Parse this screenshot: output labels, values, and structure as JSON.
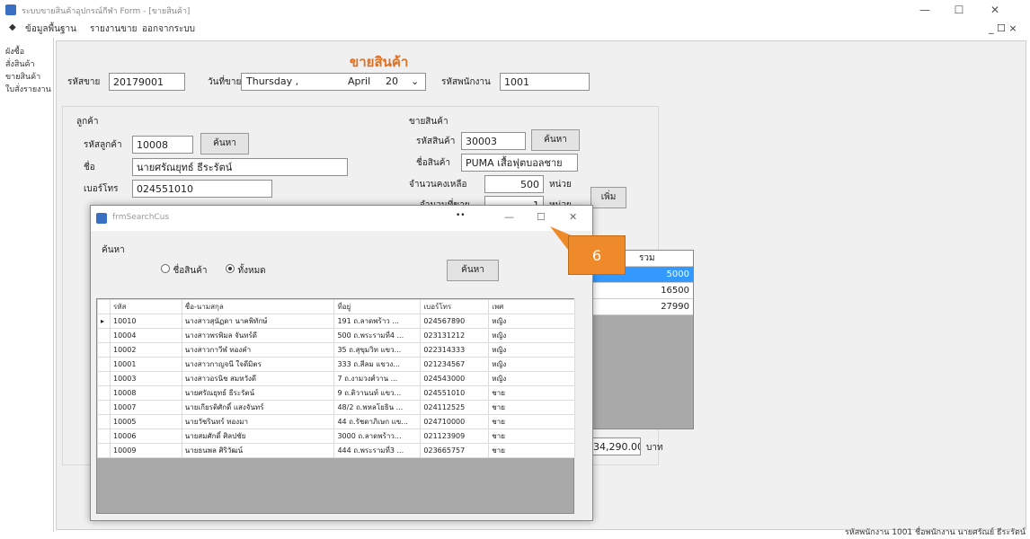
{
  "window": {
    "title": "ระบบขายสินค้าอุปกรณ์กีฬา Form - [ขายสินค้า]",
    "controls": {
      "minimize": "—",
      "maximize": "☐",
      "close": "✕"
    },
    "mdi_controls": "_ ☐ ×"
  },
  "menu": {
    "items": [
      "ข้อมูลพื้นฐาน",
      "รายงานขาย",
      "ออกจากระบบ"
    ]
  },
  "sidebar": {
    "items": [
      "ผังซื้อ",
      "สั่งสินค้า",
      "ขายสินค้า",
      "ใบสั่งรายงาน"
    ]
  },
  "sale_form": {
    "heading": "ขายสินค้า",
    "sale_id_label": "รหัสขาย",
    "sale_id": "20179001",
    "date_label": "วันที่ขาย",
    "date_weekday": "Thursday ,",
    "date_month": "April",
    "date_day": "20",
    "employee_id_label": "รหัสพนักงาน",
    "employee_id": "1001"
  },
  "customer": {
    "group_title": "ลูกค้า",
    "id_label": "รหัสลูกค้า",
    "id": "10008",
    "search_button": "ค้นหา",
    "name_label": "ชื่อ",
    "name": "นายศรัณยุทธ์ ธีระรัตน์",
    "phone_label": "เบอร์โทร",
    "phone": "024551010"
  },
  "product": {
    "group_title": "ขายสินค้า",
    "id_label": "รหัสสินค้า",
    "id": "30003",
    "search_button": "ค้นหา",
    "name_label": "ชื่อสินค้า",
    "name": "PUMA เสื้อฟุตบอลชาย",
    "stock_label": "จำนวนคงเหลือ",
    "stock": "500",
    "stock_unit": "หน่วย",
    "qty_label": "จำนวนที่ขาย",
    "qty": "1",
    "qty_unit": "หน่วย",
    "add_button": "เพิ่ม"
  },
  "right_grid": {
    "header": "รวม",
    "values": [
      "5000",
      "16500",
      "27990"
    ]
  },
  "total": {
    "value": "34,290.00",
    "unit": "บาท"
  },
  "dialog": {
    "title": "frmSearchCus",
    "controls": {
      "pin": "••",
      "minimize": "—",
      "maximize": "☐",
      "close": "✕"
    },
    "search_label": "ค้นหา",
    "radio_product": "ชื่อสินค้า",
    "radio_all": "ทั้งหมด",
    "selected_radio": "all",
    "search_button": "ค้นหา",
    "grid": {
      "columns": [
        "",
        "รหัส",
        "ชื่อ-นามสกุล",
        "ที่อยู่",
        "เบอร์โทร",
        "เพศ"
      ],
      "rows": [
        [
          "▸",
          "10010",
          "นางสาวสุนัฏดา นาคพิทักษ์",
          "191 ถ.ลาดพร้าว ...",
          "024567890",
          "หญิง"
        ],
        [
          "",
          "10004",
          "นางสาวพรพิมล จันทร์ดี",
          "500 ถ.พระรามที่4 ...",
          "023131212",
          "หญิง"
        ],
        [
          "",
          "10002",
          "นางสาวกาวีฬ ทองคำ",
          "35 ถ.สุขุมวิท แขว...",
          "022314333",
          "หญิง"
        ],
        [
          "",
          "10001",
          "นางสาวกาญจนี ใจดีมิตร",
          "333 ถ.สีลม แขวง...",
          "021234567",
          "หญิง"
        ],
        [
          "",
          "10003",
          "นางสาวอรนิช สมหวังดี",
          "7 ถ.งามวงศ์วาน ...",
          "024543000",
          "หญิง"
        ],
        [
          "",
          "10008",
          "นายศรัณยุทธ์ ธีระรัตน์",
          "9 ถ.ติวานนท์ แขว...",
          "024551010",
          "ชาย"
        ],
        [
          "",
          "10007",
          "นายเกียรติศักดิ์ แสงจันทร์",
          "48/2 ถ.พหลโยธิน ...",
          "024112525",
          "ชาย"
        ],
        [
          "",
          "10005",
          "นายวัชรินทร์ ทองมา",
          "44 ถ.รัชดาภิเษก แข...",
          "024710000",
          "ชาย"
        ],
        [
          "",
          "10006",
          "นายสมศักดิ์ ศิลปชัย",
          "3000 ถ.ลาดพร้าว...",
          "021123909",
          "ชาย"
        ],
        [
          "",
          "10009",
          "นายธนพล ศิริวัฒน์",
          "444 ถ.พระรามที่3 ...",
          "023665757",
          "ชาย"
        ]
      ]
    }
  },
  "callout": {
    "label": "6"
  },
  "status_bar": {
    "text": "รหัสพนักงาน 1001  ชื่อพนักงาน นายศรัณย์ ธีระรัตน์"
  }
}
